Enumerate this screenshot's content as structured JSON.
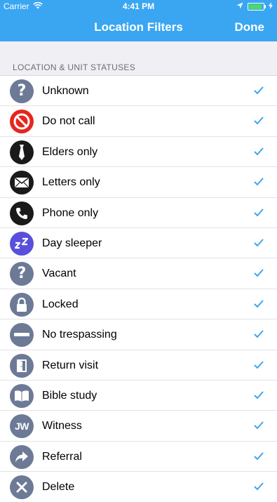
{
  "status_bar": {
    "carrier": "Carrier",
    "time": "4:41 PM"
  },
  "nav": {
    "title": "Location Filters",
    "done": "Done"
  },
  "section": {
    "title": "LOCATION & UNIT STATUSES"
  },
  "colors": {
    "accent": "#3aa6f2",
    "icon_gray": "#6c7a96",
    "icon_red": "#e5251f",
    "icon_black": "#1a1a1a",
    "icon_purple": "#5a4fdc",
    "check": "#3aa6f2"
  },
  "items": [
    {
      "label": "Unknown",
      "icon": "question-icon",
      "checked": true
    },
    {
      "label": "Do not call",
      "icon": "no-entry-icon",
      "checked": true
    },
    {
      "label": "Elders only",
      "icon": "necktie-icon",
      "checked": true
    },
    {
      "label": "Letters only",
      "icon": "envelope-icon",
      "checked": true
    },
    {
      "label": "Phone only",
      "icon": "phone-icon",
      "checked": true
    },
    {
      "label": "Day sleeper",
      "icon": "zz-icon",
      "checked": true
    },
    {
      "label": "Vacant",
      "icon": "question-icon",
      "checked": true
    },
    {
      "label": "Locked",
      "icon": "lock-icon",
      "checked": true
    },
    {
      "label": "No trespassing",
      "icon": "minus-icon",
      "checked": true
    },
    {
      "label": "Return visit",
      "icon": "door-icon",
      "checked": true
    },
    {
      "label": "Bible study",
      "icon": "book-icon",
      "checked": true
    },
    {
      "label": "Witness",
      "icon": "jw-icon",
      "checked": true
    },
    {
      "label": "Referral",
      "icon": "share-arrow-icon",
      "checked": true
    },
    {
      "label": "Delete",
      "icon": "x-icon",
      "checked": true
    }
  ]
}
